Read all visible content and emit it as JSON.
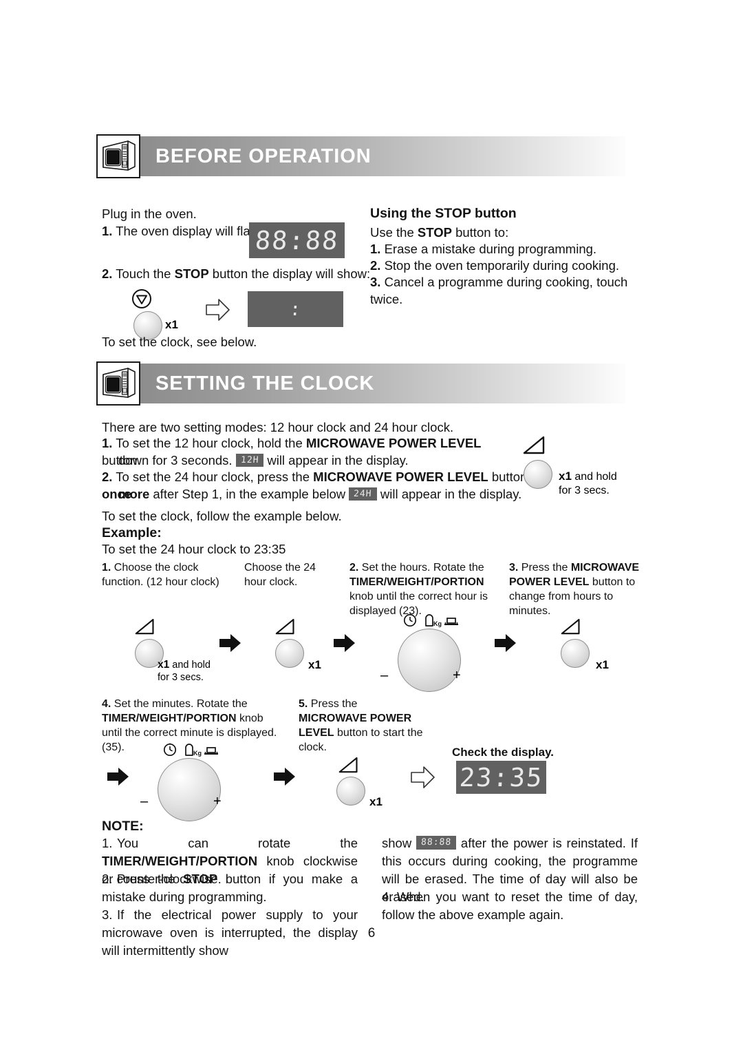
{
  "page": {
    "number": "6"
  },
  "sections": [
    {
      "id": "before-operation",
      "title": "BEFORE OPERATION",
      "icon": "microwave-oven-icon"
    },
    {
      "id": "setting-the-clock",
      "title": "SETTING THE CLOCK",
      "icon": "microwave-oven-icon"
    }
  ],
  "before_operation": {
    "left": {
      "intro": "Plug in the oven.",
      "item1_num": "1.",
      "item1_text": "The oven display will flash:",
      "display1": "88:88",
      "item2_num": "2.",
      "item2_text_a": "Touch the ",
      "item2_bold": "STOP",
      "item2_text_b": " button the display will show:",
      "stop_icon": "stop-button-icon",
      "press_count": "x1",
      "arrow": "outline-arrow-right-icon",
      "display2": ":",
      "footer": "To set the clock, see below."
    },
    "right": {
      "heading": "Using the STOP button",
      "lead_a": "Use the ",
      "lead_bold": "STOP",
      "lead_b": " button to:",
      "items": [
        {
          "num": "1.",
          "text": "Erase a mistake during programming."
        },
        {
          "num": "2.",
          "text": "Stop the oven temporarily during cooking."
        },
        {
          "num": "3.",
          "text": "Cancel a programme during cooking, touch twice."
        }
      ]
    }
  },
  "setting_the_clock": {
    "intro": "There are two setting modes: 12 hour clock and 24 hour clock.",
    "step1": {
      "num": "1.",
      "a": "To set the 12 hour clock, hold the ",
      "bold": "MICROWAVE POWER LEVEL",
      "b": " button",
      "line2_a": "down for 3 seconds.",
      "badge": "12H",
      "line2_b": "will appear in the display."
    },
    "step2": {
      "num": "2.",
      "a": "To set the 24 hour clock, press the ",
      "bold": "MICROWAVE POWER LEVEL",
      "b": " button ",
      "bold2": "once",
      "line2_bold": "more",
      "line2_a": " after Step 1, in the example below",
      "badge": "24H",
      "line2_b": "will appear in the display."
    },
    "side_hint": {
      "icon": "power-level-icon",
      "knob": "microwave-power-level-button",
      "count": "x1",
      "text_a": " and hold",
      "text_b": "for 3 secs."
    },
    "follow": "To set the clock, follow the example below.",
    "example_heading": "Example:",
    "example_sub": "To set the 24 hour clock to 23:35",
    "steps_row1": [
      {
        "num": "1.",
        "text": "Choose the clock function. (12 hour clock)"
      },
      {
        "num": "",
        "text": "Choose the 24 hour clock."
      },
      {
        "num": "2.",
        "text_a": "Set the hours. Rotate the ",
        "bold": "TIMER/WEIGHT/PORTION",
        "text_b": " knob until the correct hour is displayed (23)."
      },
      {
        "num": "3.",
        "text_a": "Press the ",
        "bold": "MICROWAVE POWER LEVEL",
        "text_b": " button to change from hours to minutes."
      }
    ],
    "icons_row1": {
      "item1_icon": "power-level-icon",
      "item1_knob": "microwave-power-level-button",
      "item1_count": "x1",
      "item1_label_a": " and hold",
      "item1_label_b": "for 3 secs.",
      "arrow1": "solid-arrow-right-icon",
      "item2_icon": "power-level-icon",
      "item2_knob": "microwave-power-level-button",
      "item2_count": "x1",
      "arrow2": "solid-arrow-right-icon",
      "item3_icons": [
        "clock-icon",
        "weight-kg-icon",
        "portion-plate-icon"
      ],
      "item3_knob": "timer-weight-portion-knob",
      "item3_minus": "–",
      "item3_plus": "+",
      "arrow3": "solid-arrow-right-icon",
      "item4_icon": "power-level-icon",
      "item4_knob": "microwave-power-level-button",
      "item4_count": "x1"
    },
    "steps_row2": [
      {
        "num": "4.",
        "text_a": "Set the minutes. Rotate the ",
        "bold": "TIMER/",
        "bold_line2": "WEIGHT/PORTION",
        "text_b": " knob until the correct minute is displayed. (35)."
      },
      {
        "num": "5.",
        "text_a": "Press the ",
        "bold": "MICROWAVE POWER LEVEL",
        "text_b": " button to start the clock."
      }
    ],
    "icons_row2": {
      "arrow0": "solid-arrow-right-icon",
      "item1_icons": [
        "clock-icon",
        "weight-kg-icon",
        "portion-plate-icon"
      ],
      "item1_knob": "timer-weight-portion-knob",
      "item1_minus": "–",
      "item1_plus": "+",
      "arrow1": "solid-arrow-right-icon",
      "item2_icon": "power-level-icon",
      "item2_knob": "microwave-power-level-button",
      "item2_count": "x1",
      "arrow2": "outline-arrow-right-icon",
      "check_label": "Check the display.",
      "final_display": "23:35"
    }
  },
  "note": {
    "heading": "NOTE:",
    "items": [
      {
        "num": "1.",
        "a": "You can rotate the ",
        "bold": "TIMER/WEIGHT/PORTION",
        "b": " knob clockwise or counter-clockwise."
      },
      {
        "num": "2.",
        "a": "Press the ",
        "bold": "STOP",
        "b": " button if you make a mistake during programming."
      },
      {
        "num": "3.",
        "a": "If the electrical power supply to your microwave oven is interrupted, the display will intermittently show",
        "badge": "88:88",
        "b": "after the power is reinstated. If this occurs during cooking, the programme will be erased. The time of day will also be erased."
      },
      {
        "num": "4.",
        "a": "When you want to reset the time of day, follow the above example again."
      }
    ]
  },
  "colors": {
    "lcd_background": "#616161",
    "lcd_text": "#e9e9e9",
    "banner_dark": "#8d8d8d",
    "banner_light": "#fdfdfd",
    "text": "#131313"
  }
}
